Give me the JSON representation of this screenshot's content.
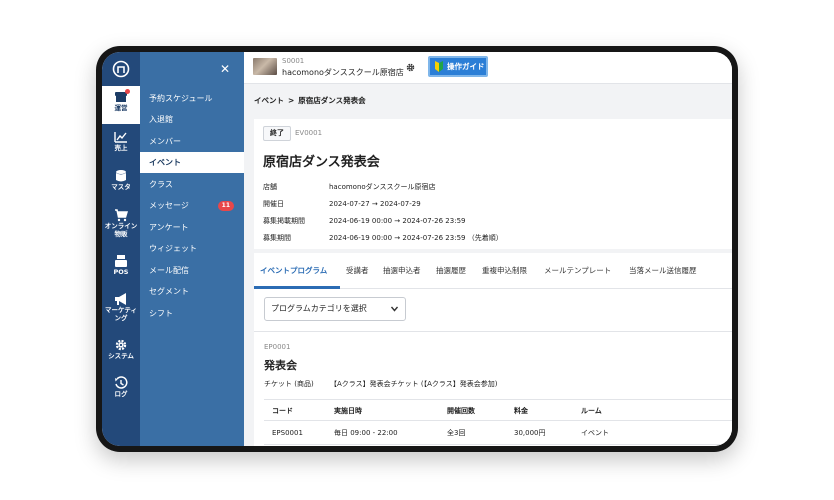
{
  "colors": {
    "rail": "#23497a",
    "submenu": "#3a6fa5",
    "accent": "#2b6cb4",
    "badge": "#e8474a",
    "guide": "#2b7ed6"
  },
  "rail": {
    "items": [
      {
        "label": "運営",
        "icon": "store-icon"
      },
      {
        "label": "売上",
        "icon": "chart-icon"
      },
      {
        "label": "マスタ",
        "icon": "database-icon"
      },
      {
        "label": "オンライン物販",
        "icon": "cart-icon"
      },
      {
        "label": "POS",
        "icon": "register-icon"
      },
      {
        "label": "マーケティング",
        "icon": "megaphone-icon"
      },
      {
        "label": "システム",
        "icon": "gear-icon"
      },
      {
        "label": "ログ",
        "icon": "history-icon"
      }
    ]
  },
  "submenu": {
    "items": [
      {
        "label": "予約スケジュール"
      },
      {
        "label": "入退館"
      },
      {
        "label": "メンバー"
      },
      {
        "label": "イベント"
      },
      {
        "label": "クラス"
      },
      {
        "label": "メッセージ",
        "badge": "11"
      },
      {
        "label": "アンケート"
      },
      {
        "label": "ウィジェット"
      },
      {
        "label": "メール配信"
      },
      {
        "label": "セグメント"
      },
      {
        "label": "シフト"
      }
    ]
  },
  "topbar": {
    "store_code": "S0001",
    "store_name": "hacomonoダンススクール原宿店",
    "guide_label": "操作ガイド"
  },
  "breadcrumb": {
    "parent": "イベント",
    "separator": ">",
    "current": "原宿店ダンス発表会"
  },
  "event": {
    "status": "終了",
    "code": "EV0001",
    "title": "原宿店ダンス発表会",
    "info": [
      {
        "key": "店舗",
        "value": "hacomonoダンススクール原宿店"
      },
      {
        "key": "開催日",
        "value": "2024-07-27 → 2024-07-29"
      },
      {
        "key": "募集掲載期間",
        "value": "2024-06-19 00:00 → 2024-07-26 23:59"
      },
      {
        "key": "募集期間",
        "value": "2024-06-19 00:00 → 2024-07-26 23:59 （先着順）"
      }
    ]
  },
  "tabs": [
    "イベントプログラム",
    "受講者",
    "抽選申込者",
    "抽選履歴",
    "重複申込制限",
    "メールテンプレート",
    "当落メール送信履歴"
  ],
  "program": {
    "category_placeholder": "プログラムカテゴリを選択",
    "code": "EP0001",
    "title": "発表会",
    "ticket_key": "チケット (商品)",
    "ticket_value": "【Aクラス】発表会チケット (【Aクラス】発表会参加)",
    "table": {
      "headers": [
        "コード",
        "実施日時",
        "開催回数",
        "料金",
        "ルーム"
      ],
      "rows": [
        [
          "EPS0001",
          "毎日 09:00 - 22:00",
          "全3回",
          "30,000円",
          "イベント"
        ]
      ]
    }
  }
}
